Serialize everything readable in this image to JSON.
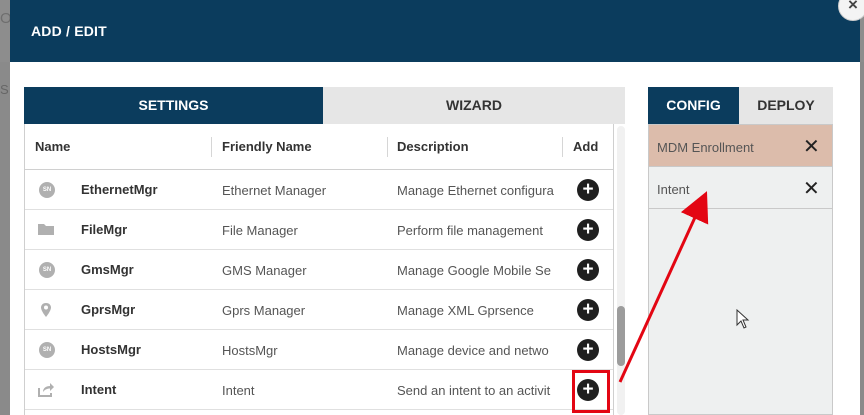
{
  "modal": {
    "title": "ADD / EDIT",
    "close_label": "×"
  },
  "left_tabs": {
    "settings": "SETTINGS",
    "wizard": "WIZARD"
  },
  "table": {
    "headers": {
      "name": "Name",
      "friendly": "Friendly Name",
      "description": "Description",
      "add": "Add"
    },
    "rows": [
      {
        "icon": "sn-circle-icon",
        "icon_text": "SN",
        "name": "EthernetMgr",
        "friendly": "Ethernet Manager",
        "description": "Manage Ethernet configura"
      },
      {
        "icon": "folder-icon",
        "name": "FileMgr",
        "friendly": "File Manager",
        "description": "Perform file management"
      },
      {
        "icon": "sn-circle-icon",
        "icon_text": "SN",
        "name": "GmsMgr",
        "friendly": "GMS Manager",
        "description": "Manage Google Mobile Se"
      },
      {
        "icon": "location-pin-icon",
        "name": "GprsMgr",
        "friendly": "Gprs Manager",
        "description": "Manage XML Gprsence"
      },
      {
        "icon": "sn-circle-icon",
        "icon_text": "SN",
        "name": "HostsMgr",
        "friendly": "HostsMgr",
        "description": "Manage device and netwo"
      },
      {
        "icon": "share-icon",
        "name": "Intent",
        "friendly": "Intent",
        "description": "Send an intent to an activit"
      }
    ],
    "add_symbol": "+"
  },
  "right_tabs": {
    "config": "CONFIG",
    "deploy": "DEPLOY"
  },
  "config_items": [
    {
      "label": "MDM Enrollment",
      "selected": true
    },
    {
      "label": "Intent",
      "selected": false
    }
  ],
  "remove_symbol": "✕",
  "colors": {
    "header": "#0b3c5d",
    "selected_item": "#dcbcab",
    "annotation": "#e30613"
  }
}
